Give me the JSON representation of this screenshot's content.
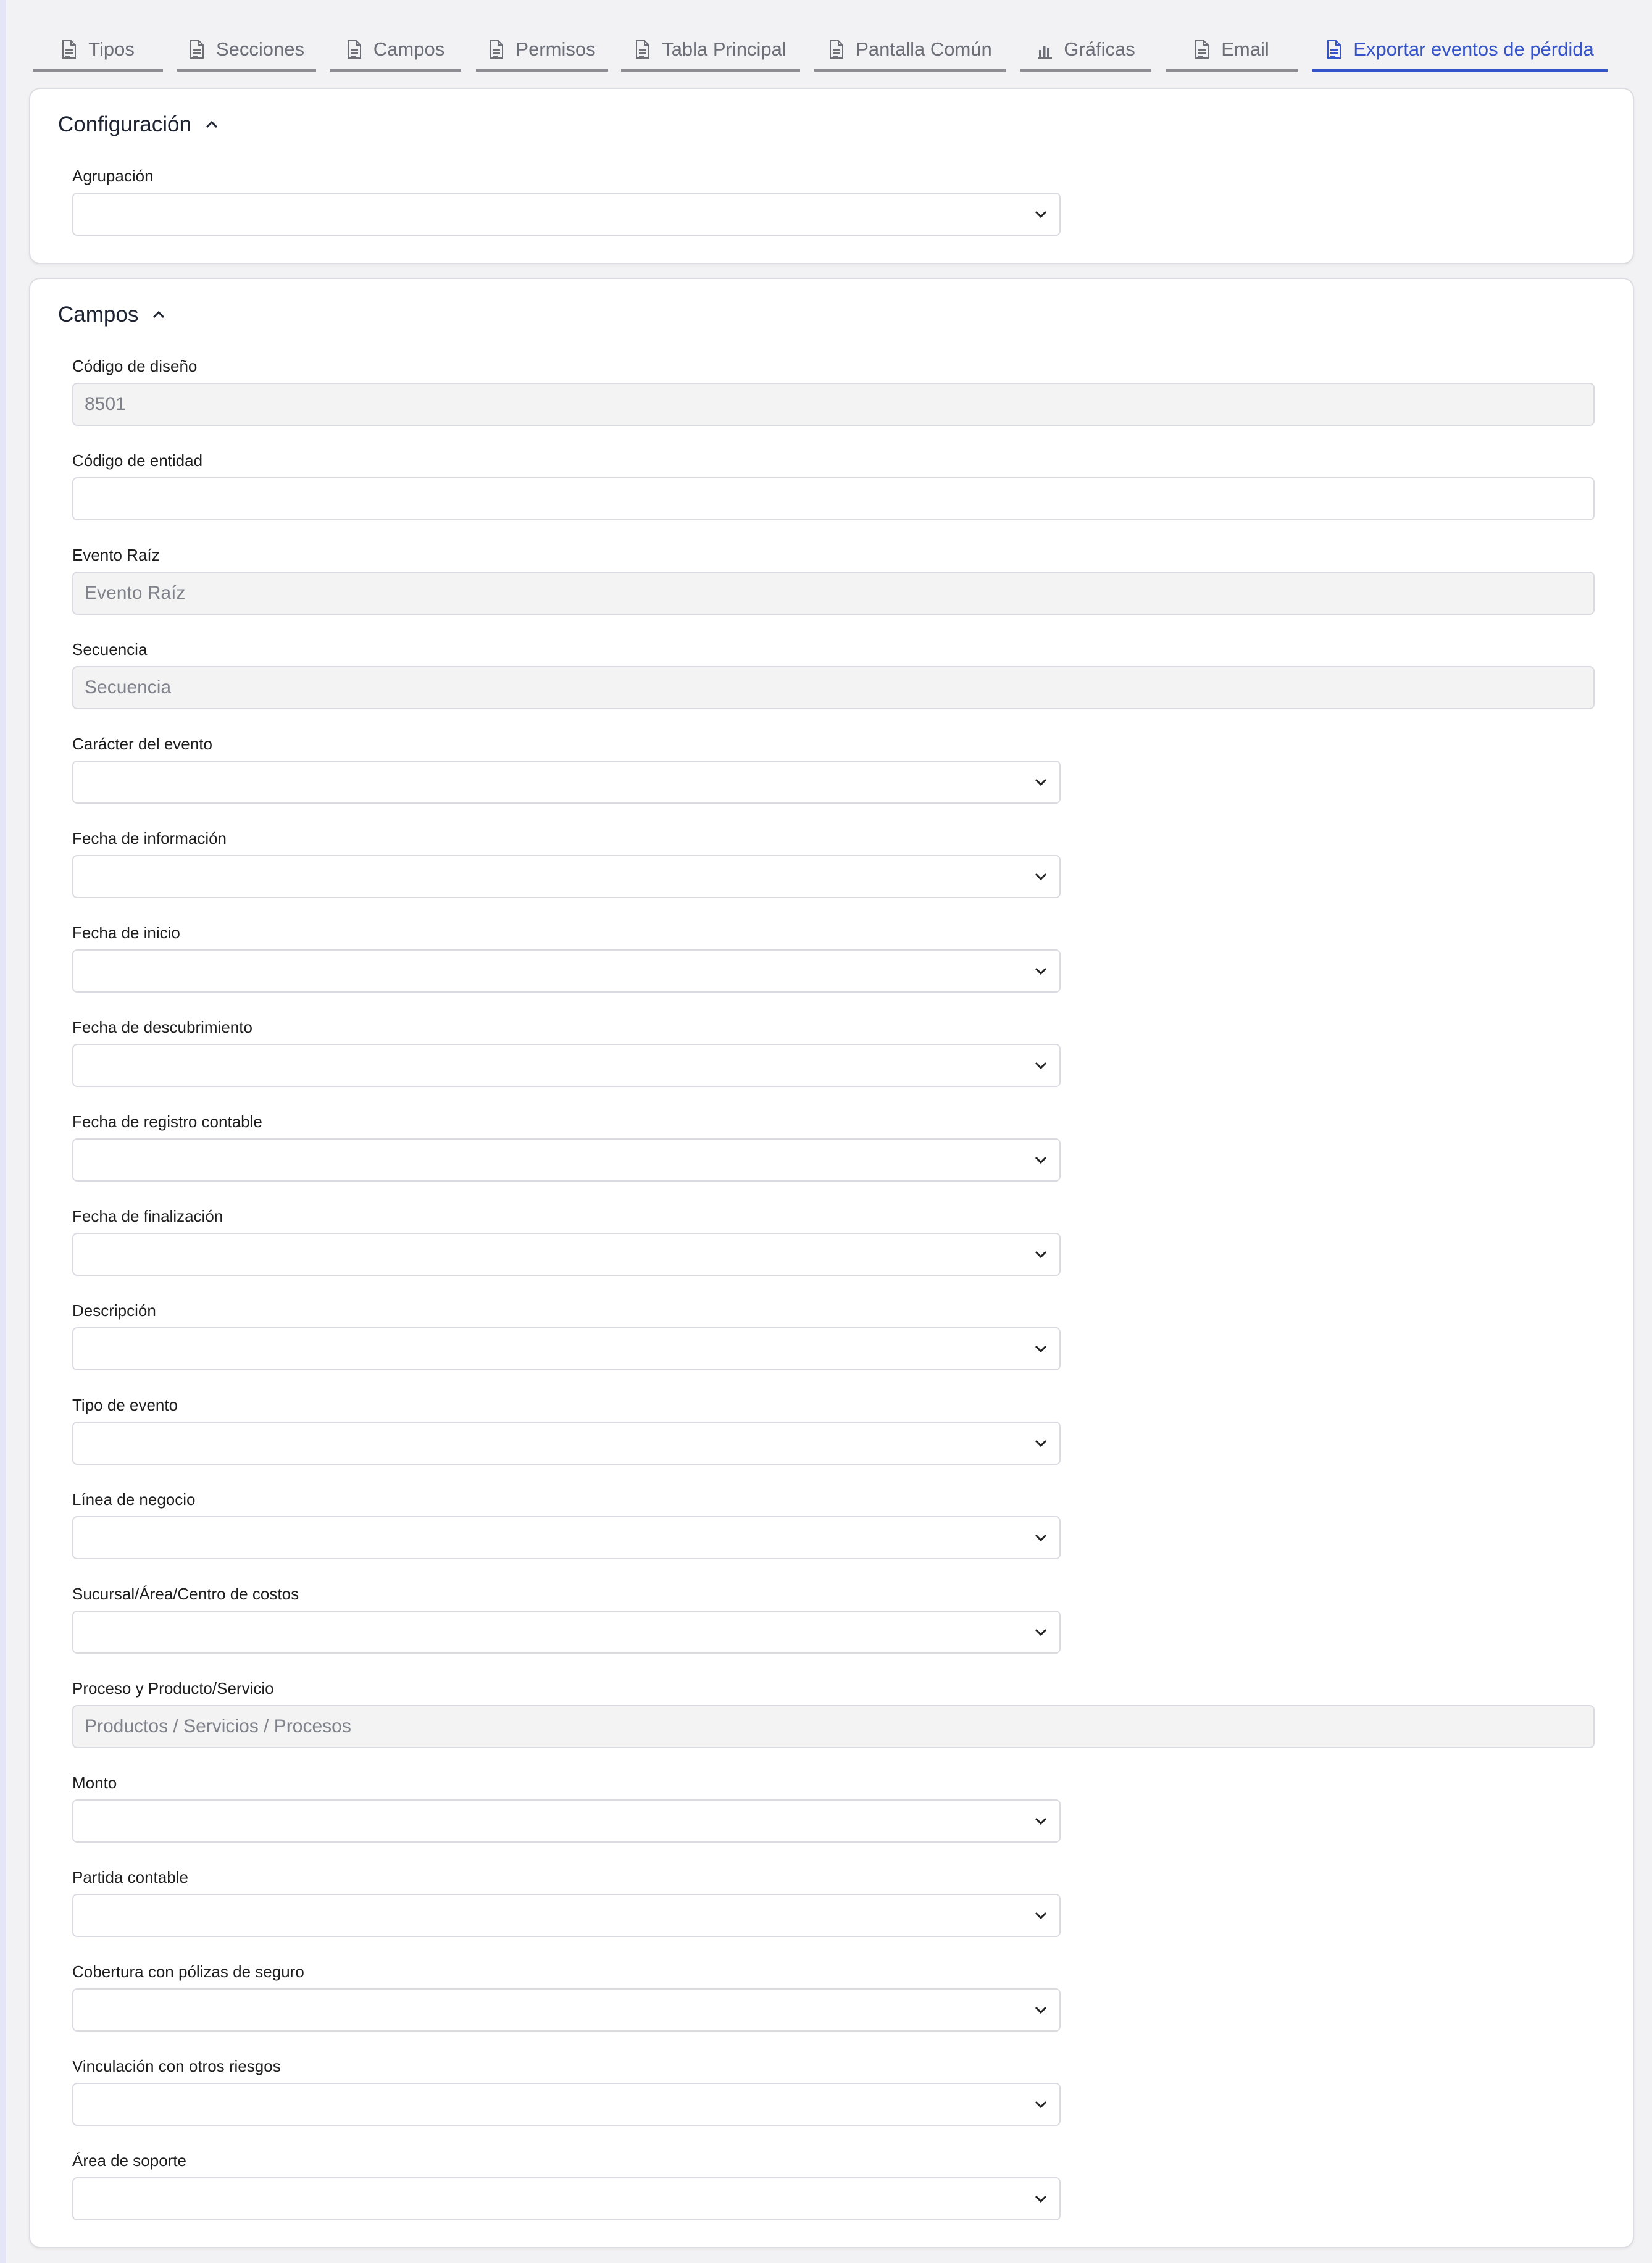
{
  "tabs": [
    {
      "label": "Tipos",
      "icon": "document-icon",
      "active": false
    },
    {
      "label": "Secciones",
      "icon": "document-icon",
      "active": false
    },
    {
      "label": "Campos",
      "icon": "document-icon",
      "active": false
    },
    {
      "label": "Permisos",
      "icon": "document-icon",
      "active": false
    },
    {
      "label": "Tabla Principal",
      "icon": "document-icon",
      "active": false
    },
    {
      "label": "Pantalla Común",
      "icon": "document-icon",
      "active": false
    },
    {
      "label": "Gráficas",
      "icon": "bar-chart-icon",
      "active": false
    },
    {
      "label": "Email",
      "icon": "document-icon",
      "active": false
    },
    {
      "label": "Exportar eventos de pérdida",
      "icon": "document-icon",
      "active": true
    }
  ],
  "colors": {
    "accent": "#3554c9",
    "tab_inactive": "#6d6f78",
    "readonly_bg": "#f3f3f3"
  },
  "config": {
    "title": "Configuración",
    "agrupacion": {
      "label": "Agrupación",
      "value": ""
    }
  },
  "campos": {
    "title": "Campos",
    "fields": [
      {
        "label": "Código de diseño",
        "type": "input",
        "readonly": true,
        "value": "8501",
        "placeholder": ""
      },
      {
        "label": "Código de entidad",
        "type": "input",
        "readonly": false,
        "value": "",
        "placeholder": ""
      },
      {
        "label": "Evento Raíz",
        "type": "input",
        "readonly": true,
        "value": "",
        "placeholder": "Evento Raíz"
      },
      {
        "label": "Secuencia",
        "type": "input",
        "readonly": true,
        "value": "",
        "placeholder": "Secuencia"
      },
      {
        "label": "Carácter del evento",
        "type": "select",
        "value": ""
      },
      {
        "label": "Fecha de información",
        "type": "select",
        "value": ""
      },
      {
        "label": "Fecha de inicio",
        "type": "select",
        "value": ""
      },
      {
        "label": "Fecha de descubrimiento",
        "type": "select",
        "value": ""
      },
      {
        "label": "Fecha de registro contable",
        "type": "select",
        "value": ""
      },
      {
        "label": "Fecha de finalización",
        "type": "select",
        "value": ""
      },
      {
        "label": "Descripción",
        "type": "select",
        "value": ""
      },
      {
        "label": "Tipo de evento",
        "type": "select",
        "value": ""
      },
      {
        "label": "Línea de negocio",
        "type": "select",
        "value": ""
      },
      {
        "label": "Sucursal/Área/Centro de costos",
        "type": "select",
        "value": ""
      },
      {
        "label": "Proceso y Producto/Servicio",
        "type": "input",
        "readonly": true,
        "value": "",
        "placeholder": "Productos / Servicios / Procesos"
      },
      {
        "label": "Monto",
        "type": "select",
        "value": ""
      },
      {
        "label": "Partida contable",
        "type": "select",
        "value": ""
      },
      {
        "label": "Cobertura con pólizas de seguro",
        "type": "select",
        "value": ""
      },
      {
        "label": "Vinculación con otros riesgos",
        "type": "select",
        "value": ""
      },
      {
        "label": "Área de soporte",
        "type": "select",
        "value": ""
      }
    ]
  }
}
